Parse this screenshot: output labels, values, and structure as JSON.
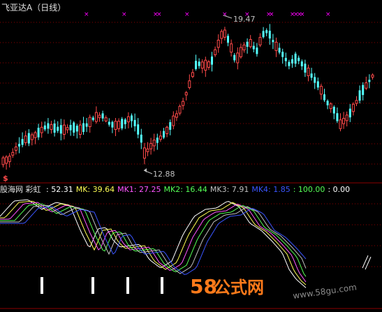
{
  "window": {
    "title": "飞亚达A（日线）"
  },
  "price_panel": {
    "high_marker": "19.47",
    "low_marker": "12.88",
    "signal_glyph": "$",
    "colors": {
      "up": "#ff4a4a",
      "down": "#54ffff",
      "x_marker": "#ff00ff",
      "grid": "#8b0000",
      "annotation": "#c0c0c0"
    }
  },
  "indicator_panel": {
    "name": "股海网 彩虹",
    "values": [
      {
        "label": "",
        "text": ": 52.31",
        "color": "#ffffff"
      },
      {
        "label": "MK",
        "text": ": 39.64",
        "color": "#ffff55"
      },
      {
        "label": "MK1",
        "text": ": 27.25",
        "color": "#ff55ff"
      },
      {
        "label": "MK2",
        "text": ": 16.44",
        "color": "#55ff55"
      },
      {
        "label": "MK3",
        "text": ": 7.91",
        "color": "#c0c0c0"
      },
      {
        "label": "MK4",
        "text": ": 1.85",
        "color": "#3a55ff"
      },
      {
        "label": "",
        "text": ": 100.00",
        "color": "#55ff55"
      },
      {
        "label": "",
        "text": ": 0.00",
        "color": "#ffffff"
      }
    ],
    "line_colors": [
      "#ffffff",
      "#ffff55",
      "#ff55ff",
      "#55ff55",
      "#c0c0c0",
      "#3a55ff"
    ]
  },
  "watermark": {
    "brand_num": "58",
    "brand_cn": "公式网",
    "url": "www.58gu.com"
  }
}
